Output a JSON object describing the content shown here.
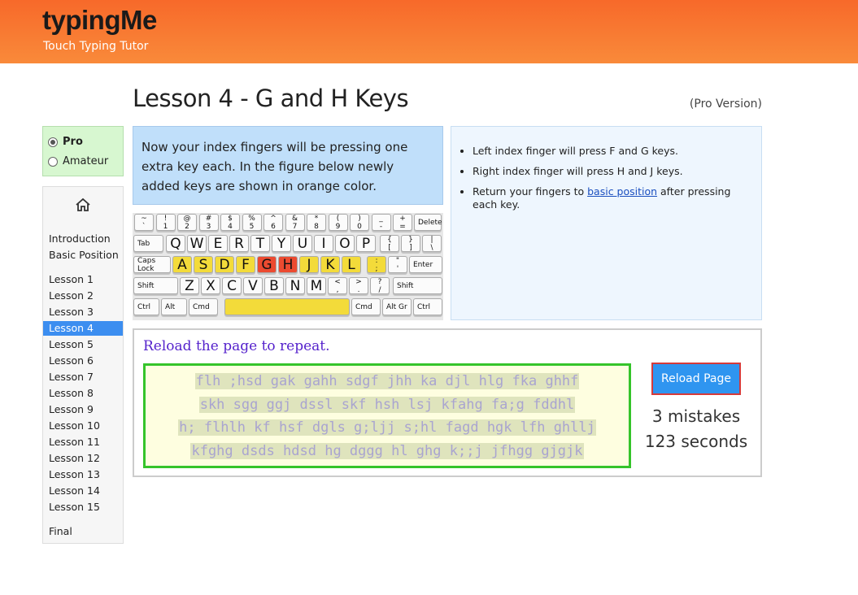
{
  "brand": {
    "title": "typingMe",
    "subtitle": "Touch Typing Tutor"
  },
  "page": {
    "title": "Lesson 4 - G and H Keys",
    "version": "(Pro Version)"
  },
  "mode": {
    "options": [
      "Pro",
      "Amateur"
    ],
    "selected": "Pro"
  },
  "sidebar": {
    "home_icon": "home-icon",
    "items": [
      "Introduction",
      "Basic Position",
      "Lesson 1",
      "Lesson 2",
      "Lesson 3",
      "Lesson 4",
      "Lesson 5",
      "Lesson 6",
      "Lesson 7",
      "Lesson 8",
      "Lesson 9",
      "Lesson 10",
      "Lesson 11",
      "Lesson 12",
      "Lesson 13",
      "Lesson 14",
      "Lesson 15",
      "Final"
    ],
    "active": "Lesson 4"
  },
  "intro": {
    "text": "Now your index fingers will be pressing one extra key each. In the figure below newly added keys are shown in orange color."
  },
  "tips": {
    "item1": "Left index finger will press F and G keys.",
    "item2": "Right index finger will press H and J keys.",
    "item3_before": "Return your fingers to ",
    "item3_link": "basic position",
    "item3_after": " after pressing each key."
  },
  "keyboard": {
    "row1": [
      [
        "~",
        "`"
      ],
      [
        "!",
        "1"
      ],
      [
        "@",
        "2"
      ],
      [
        "#",
        "3"
      ],
      [
        "$",
        "4"
      ],
      [
        "%",
        "5"
      ],
      [
        "^",
        "6"
      ],
      [
        "&",
        "7"
      ],
      [
        "*",
        "8"
      ],
      [
        "(",
        "9"
      ],
      [
        ")",
        "0"
      ],
      [
        "_",
        "-"
      ],
      [
        "+",
        "="
      ]
    ],
    "row1_end": "Delete",
    "row2_start": "Tab",
    "row2": [
      "Q",
      "W",
      "E",
      "R",
      "T",
      "Y",
      "U",
      "I",
      "O",
      "P"
    ],
    "row2_extra": [
      [
        "{",
        "["
      ],
      [
        "}",
        "]"
      ],
      [
        "|",
        "\\"
      ]
    ],
    "row3_start": "Caps Lock",
    "row3": [
      "A",
      "S",
      "D",
      "F",
      "G",
      "H",
      "J",
      "K",
      "L"
    ],
    "row3_extra": [
      [
        ":",
        ";"
      ],
      [
        "\"",
        "'"
      ]
    ],
    "row3_end": "Enter",
    "row4_start": "Shift",
    "row4": [
      "Z",
      "X",
      "C",
      "V",
      "B",
      "N",
      "M"
    ],
    "row4_extra": [
      [
        "<",
        ","
      ],
      [
        ">",
        "."
      ],
      [
        "?",
        "/"
      ]
    ],
    "row4_end": "Shift",
    "row5_left": [
      "Ctrl",
      "Alt",
      "Cmd"
    ],
    "row5_right": [
      "Cmd",
      "Alt Gr",
      "Ctrl"
    ],
    "highlight_yellow": [
      "A",
      "S",
      "D",
      "F",
      "J",
      "K",
      "L",
      ";"
    ],
    "highlight_new": [
      "G",
      "H"
    ],
    "colors": {
      "home": "#f3db3a",
      "new": "#ec4a30"
    }
  },
  "practice": {
    "reload_message": "Reload the page to repeat.",
    "lines": [
      "flh ;hsd gak gahh sdgf jhh ka djl hlg fka ghhf ",
      "skh sgg ggj dssl skf hsh lsj kfahg fa;g fddhl ",
      "h; flhlh kf hsf dgls g;ljj s;hl fagd hgk lfh ghllj ",
      "kfghg dsds hdsd hg dggg hl ghg k;;j jfhgg gjgjk"
    ],
    "reload_button": "Reload Page",
    "mistakes": "3 mistakes",
    "seconds": "123 seconds"
  }
}
